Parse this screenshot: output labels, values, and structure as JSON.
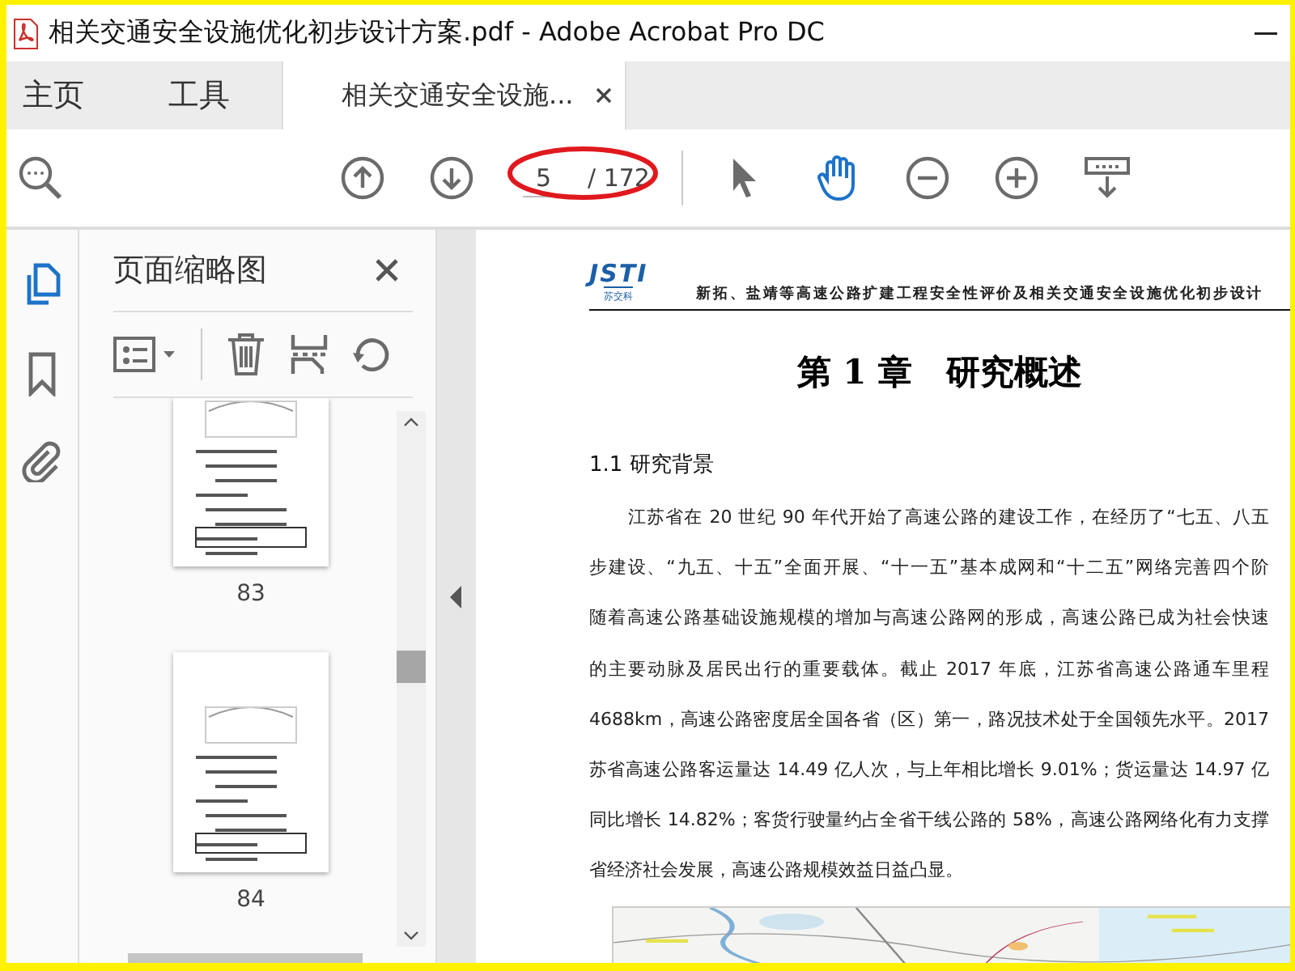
{
  "window": {
    "title": "相关交通安全设施优化初步设计方案.pdf - Adobe Acrobat Pro DC"
  },
  "tabs": [
    {
      "label": "主页",
      "selected": false,
      "closable": false
    },
    {
      "label": "工具",
      "selected": false,
      "closable": false
    },
    {
      "label": "相关交通安全设施...",
      "selected": true,
      "closable": true
    }
  ],
  "toolbar": {
    "page_field": {
      "value": "5"
    },
    "page_total": "/ 172",
    "tools": [
      {
        "kind": "pointer",
        "selected": false
      },
      {
        "kind": "hand",
        "selected": true
      }
    ]
  },
  "nav": [
    {
      "kind": "pages",
      "selected": true
    },
    {
      "kind": "bookmarks",
      "selected": false
    },
    {
      "kind": "attachments",
      "selected": false
    }
  ],
  "thumbnails_panel": {
    "title": "页面缩略图",
    "pages": [
      {
        "label": "83",
        "cut_top": true
      },
      {
        "label": "84",
        "cut_top": false
      }
    ]
  },
  "document": {
    "logo": {
      "mark": "JSTI",
      "subtitle": "苏交科"
    },
    "header_text": "新拓、盐靖等高速公路扩建工程安全性评价及相关交通安全设施优化初步设计",
    "chapter_title": "第 1 章　研究概述",
    "section_title": "1.1 研究背景",
    "paragraph_lines": [
      "江苏省在 20 世纪 90 年代开始了高速公路的建设工作，在经历了“七五、八五",
      "步建设、“九五、十五”全面开展、“十一五”基本成网和“十二五”网络完善四个阶",
      "随着高速公路基础设施规模的增加与高速公路网的形成，高速公路已成为社会快速",
      "的主要动脉及居民出行的重要载体。截止 2017 年底，江苏省高速公路通车里程",
      "4688km，高速公路密度居全国各省（区）第一，路况技术处于全国领先水平。2017",
      "苏省高速公路客运量达 14.49 亿人次，与上年相比增长 9.01%；货运量达 14.97 亿",
      "同比增长 14.82%；客货行驶量约占全省干线公路的 58%，高速公路网络化有力支撑",
      "省经济社会发展，高速公路规模效益日益凸显。"
    ]
  }
}
